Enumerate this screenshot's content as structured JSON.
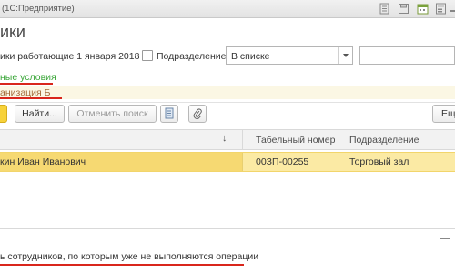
{
  "window": {
    "title": "(1С:Предприятие)",
    "controls": [
      "bookmark-icon",
      "save-icon",
      "calendar-icon",
      "calculator-icon",
      "minimize-icon"
    ]
  },
  "page": {
    "heading": "ики"
  },
  "filter": {
    "label": "ики работающие 1 января 2018 г.",
    "subdivision_checked": false,
    "subdivision_label": "Подразделение",
    "subdivision_value": "В списке",
    "right_input_value": ""
  },
  "links": {
    "special_conditions": "ные условия",
    "organization": "анизация Б"
  },
  "toolbar": {
    "find_label": "Найти...",
    "cancel_search_label": "Отменить поиск",
    "list_icon": "list-icon",
    "attach_icon": "paperclip-icon",
    "more_label": "Ещ"
  },
  "table": {
    "columns": [
      "",
      "Табельный номер",
      "Подразделение"
    ],
    "sort_indicator": "↓",
    "rows": [
      {
        "name": "кин Иван Иванович",
        "number": "00ЗП-00255",
        "subdivision": "Торговый зал"
      }
    ]
  },
  "footer": {
    "note": "ь сотрудников, по которым уже не выполняются операции"
  },
  "colors": {
    "accent_yellow": "#f7d23a",
    "link_green": "#3aa638",
    "underline_red": "#d9261c",
    "selected_row": "#fbeaa4"
  }
}
